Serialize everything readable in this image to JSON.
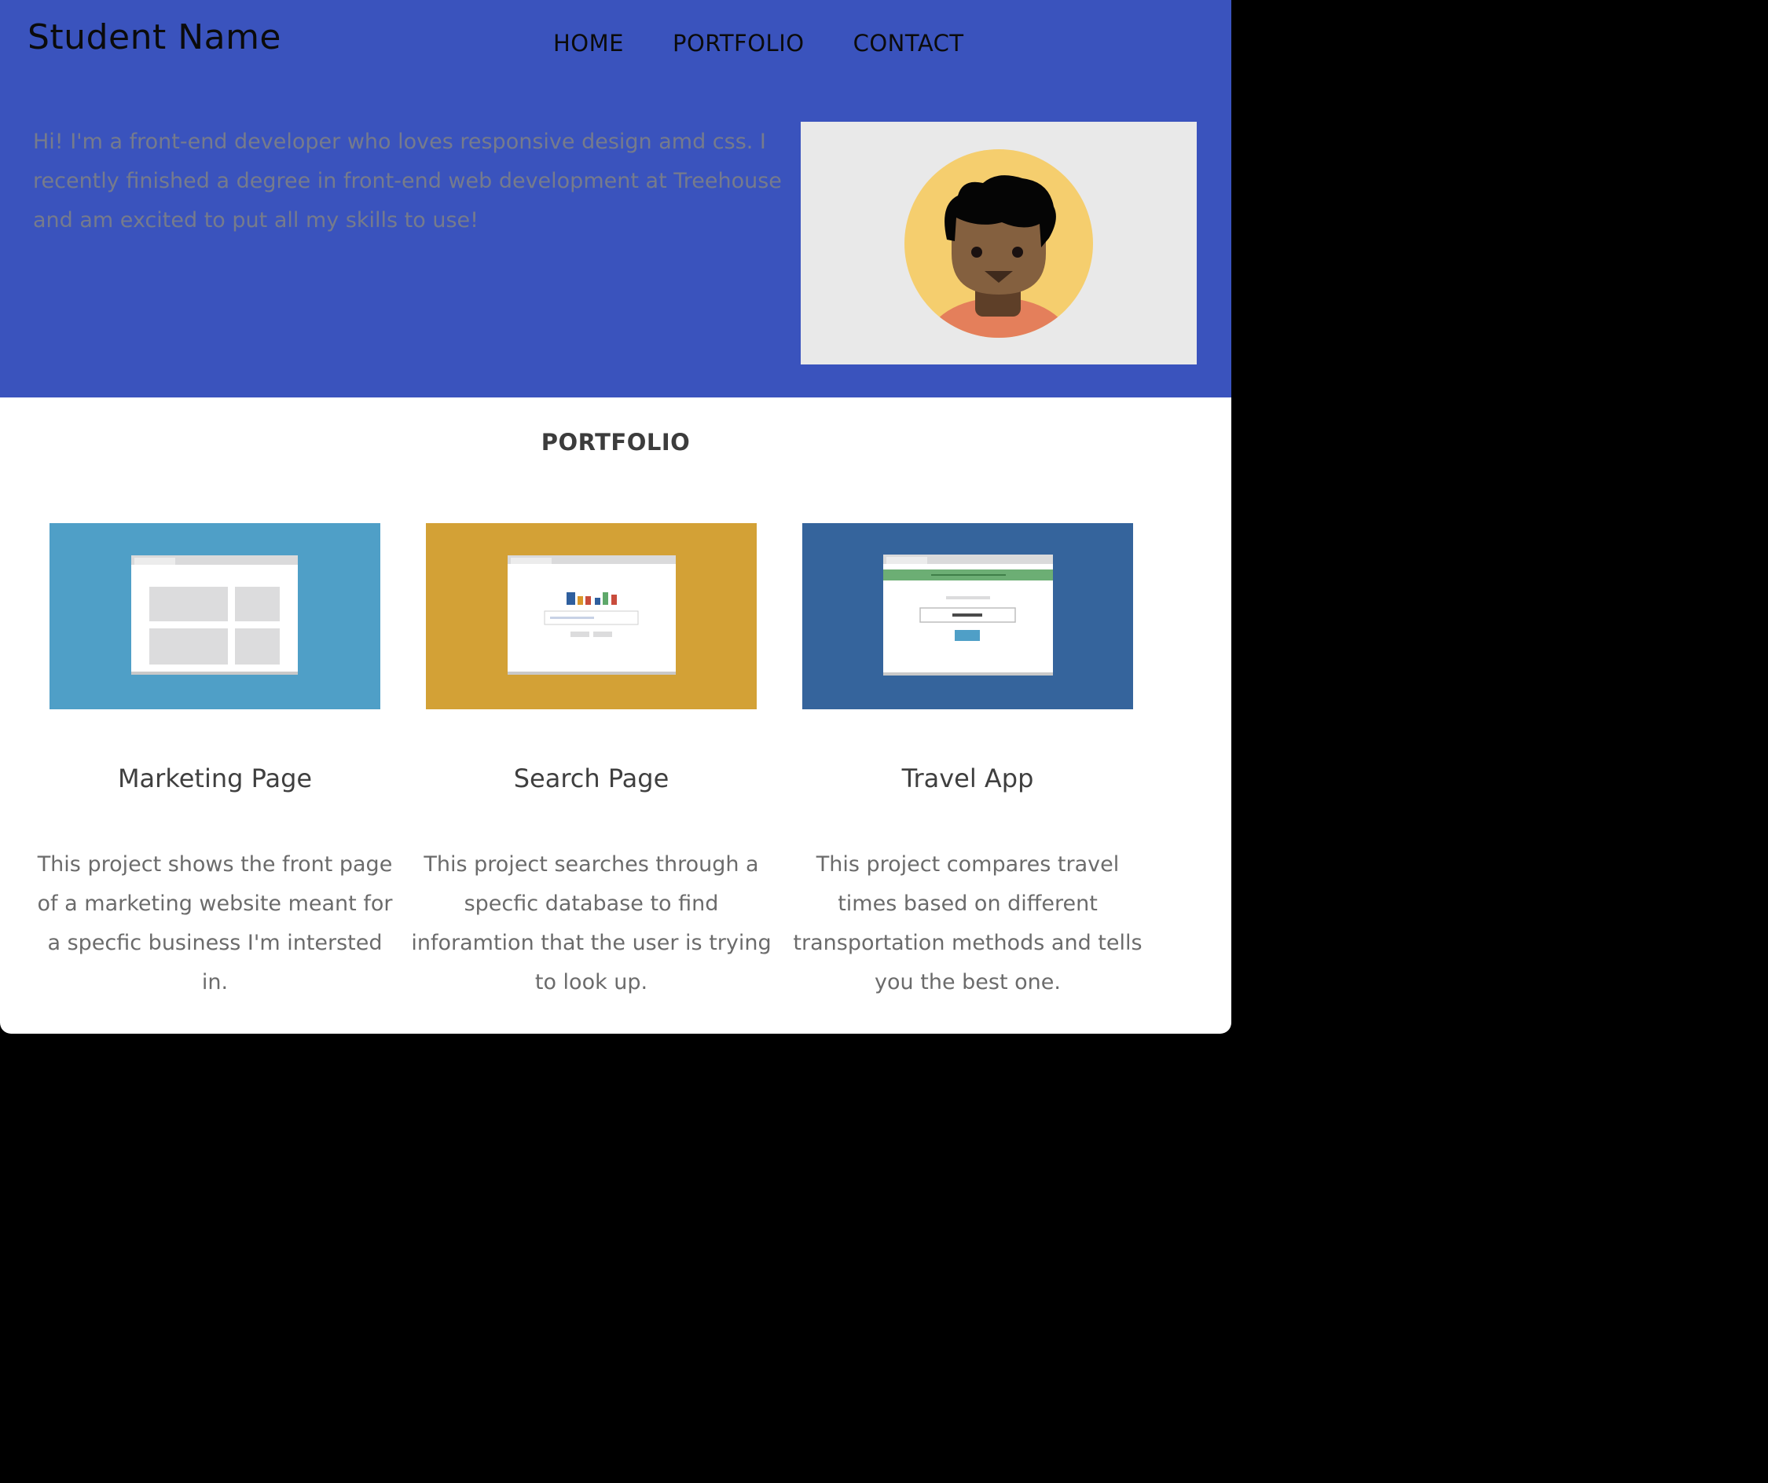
{
  "header": {
    "brand": "Student Name",
    "nav": [
      {
        "label": "HOME"
      },
      {
        "label": "PORTFOLIO"
      },
      {
        "label": "CONTACT"
      }
    ]
  },
  "hero": {
    "intro": "Hi! I'm a front-end developer who loves responsive design amd css. I recently finished a degree in front-end web development at Treehouse and am excited to put all my skills to use!",
    "avatar_icon": "person-avatar-icon"
  },
  "portfolio": {
    "title": "PORTFOLIO",
    "projects": [
      {
        "title": "Marketing Page",
        "description": "This project shows the front page of a marketing website meant for a specfic business I'm intersted in.",
        "thumb_color": "#4f9fc7",
        "thumb_icon": "marketing-layout-icon"
      },
      {
        "title": "Search Page",
        "description": "This project searches through a specfic database to find inforamtion that the user is trying to look up.",
        "thumb_color": "#d3a136",
        "thumb_icon": "search-page-icon"
      },
      {
        "title": "Travel App",
        "description": "This project compares travel times based on different transportation methods and tells you the best one.",
        "thumb_color": "#35649c",
        "thumb_icon": "travel-app-icon"
      }
    ]
  },
  "colors": {
    "header_bg": "#3a53bd",
    "avatar_bg": "#e9e9e9",
    "avatar_circle": "#f5ce6e"
  }
}
